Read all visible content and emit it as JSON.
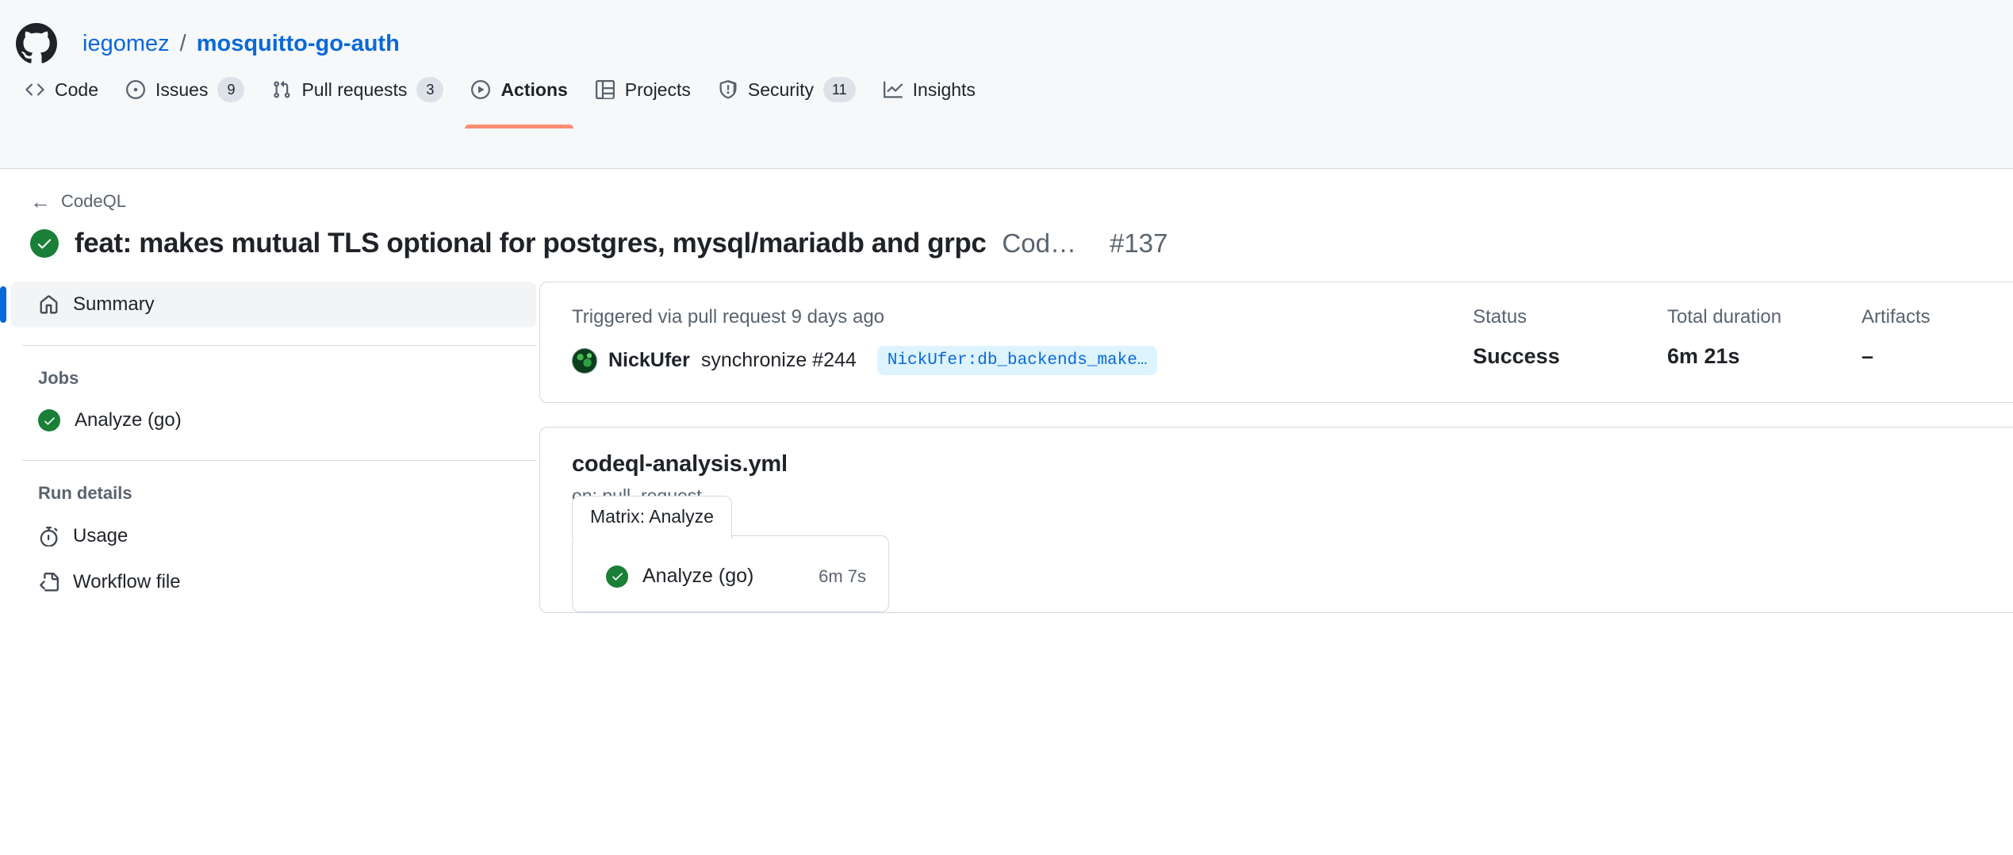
{
  "header": {
    "logo_icon": "github-mark-icon",
    "owner": "iegomez",
    "separator": "/",
    "repo": "mosquitto-go-auth",
    "tabs": [
      {
        "label": "Code",
        "icon": "code-icon",
        "count": null,
        "selected": false
      },
      {
        "label": "Issues",
        "icon": "issue-opened-icon",
        "count": "9",
        "selected": false
      },
      {
        "label": "Pull requests",
        "icon": "git-pull-request-icon",
        "count": "3",
        "selected": false
      },
      {
        "label": "Actions",
        "icon": "play-icon",
        "count": null,
        "selected": true
      },
      {
        "label": "Projects",
        "icon": "table-icon",
        "count": null,
        "selected": false
      },
      {
        "label": "Security",
        "icon": "shield-icon",
        "count": "11",
        "selected": false
      },
      {
        "label": "Insights",
        "icon": "graph-icon",
        "count": null,
        "selected": false
      }
    ]
  },
  "run": {
    "back_label": "CodeQL",
    "back_icon": "arrow-left-icon",
    "status_icon": "check-circle-icon",
    "title": "feat: makes mutual TLS optional for postgres, mysql/mariadb and grpc",
    "workflow_short": "Cod…",
    "number": "#137"
  },
  "sidebar": {
    "summary": {
      "label": "Summary",
      "icon": "home-icon"
    },
    "jobs_heading": "Jobs",
    "jobs": [
      {
        "label": "Analyze (go)",
        "icon": "check-circle-icon",
        "status": "success"
      }
    ],
    "run_details_heading": "Run details",
    "details": [
      {
        "label": "Usage",
        "icon": "stopwatch-icon"
      },
      {
        "label": "Workflow file",
        "icon": "file-code-icon"
      }
    ]
  },
  "summary": {
    "trigger_text": "Triggered via pull request 9 days ago",
    "actor": "NickUfer",
    "event": "synchronize #244",
    "branch": "NickUfer:db_backends_make…",
    "status_label": "Status",
    "status_value": "Success",
    "duration_label": "Total duration",
    "duration_value": "6m 21s",
    "artifacts_label": "Artifacts",
    "artifacts_value": "–"
  },
  "workflow": {
    "file_name": "codeql-analysis.yml",
    "on_text": "on: pull_request",
    "matrix_tab_label": "Matrix: Analyze",
    "matrix_jobs": [
      {
        "name": "Analyze (go)",
        "duration": "6m 7s",
        "icon": "check-circle-icon"
      }
    ]
  },
  "colors": {
    "accent": "#0969da",
    "success": "#1a7f37",
    "active_tab_underline": "#fd8c73",
    "header_bg": "#f6f8fa",
    "border": "#d1d9e0"
  }
}
